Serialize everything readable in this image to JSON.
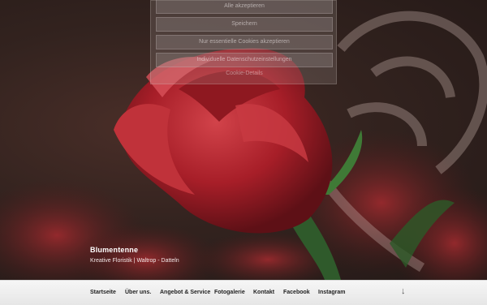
{
  "consent": {
    "buttons": [
      "Alle akzeptieren",
      "Speichern",
      "Nur essentielle Cookies akzeptieren",
      "Individuelle Datenschutzeinstellungen"
    ],
    "link": "Cookie-Details"
  },
  "brand": {
    "title": "Blumentenne",
    "tagline": "Kreative Floristik | Waltrop - Datteln"
  },
  "nav": {
    "items": [
      "Startseite",
      "Über uns.",
      "Angebot & Service",
      "Fotogalerie",
      "Kontakt",
      "Facebook",
      "Instagram"
    ],
    "scroll_icon": "arrow-down-icon"
  },
  "colors": {
    "rose": "#b3262e",
    "rose_dark": "#7a141c",
    "navbar": "#eeeeee"
  }
}
